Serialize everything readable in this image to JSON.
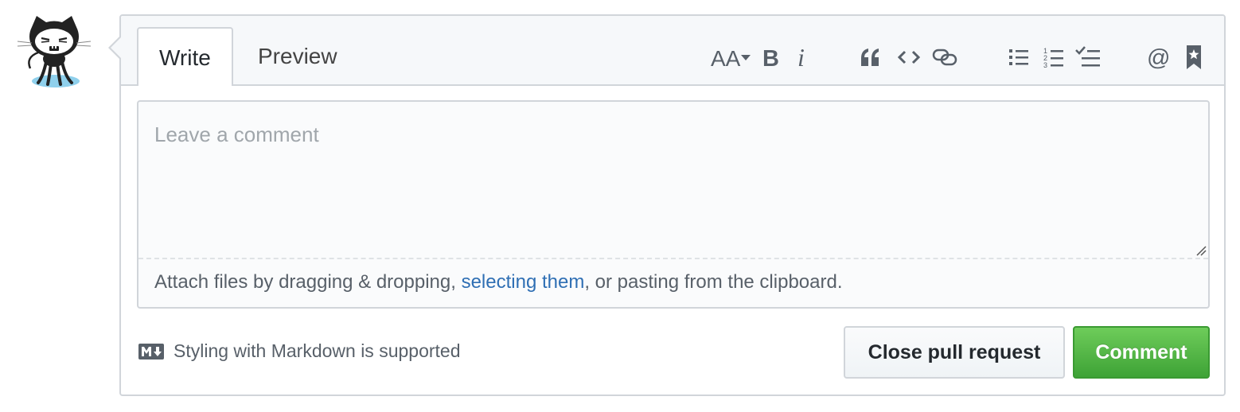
{
  "tabs": [
    {
      "label": "Write",
      "active": true
    },
    {
      "label": "Preview",
      "active": false
    }
  ],
  "toolbar": [
    {
      "name": "header-text-icon",
      "glyph": "AA▾"
    },
    {
      "name": "bold-icon",
      "glyph": "B"
    },
    {
      "name": "italic-icon",
      "glyph": "i"
    },
    {
      "name": "quote-icon"
    },
    {
      "name": "code-icon"
    },
    {
      "name": "link-icon"
    },
    {
      "name": "bulleted-list-icon"
    },
    {
      "name": "numbered-list-icon"
    },
    {
      "name": "task-list-icon"
    },
    {
      "name": "mention-icon",
      "glyph": "@"
    },
    {
      "name": "saved-reply-icon"
    }
  ],
  "editor": {
    "placeholder": "Leave a comment",
    "value": ""
  },
  "drop_zone": {
    "text_before": "Attach files by dragging & dropping, ",
    "link": "selecting them",
    "text_after": ", or pasting from the clipboard."
  },
  "markdown_note": "Styling with Markdown is supported",
  "buttons": {
    "close": "Close pull request",
    "comment": "Comment"
  },
  "colors": {
    "accent_green": "#4cae3f",
    "link_blue": "#2f6fb4",
    "border": "#d1d5da"
  }
}
